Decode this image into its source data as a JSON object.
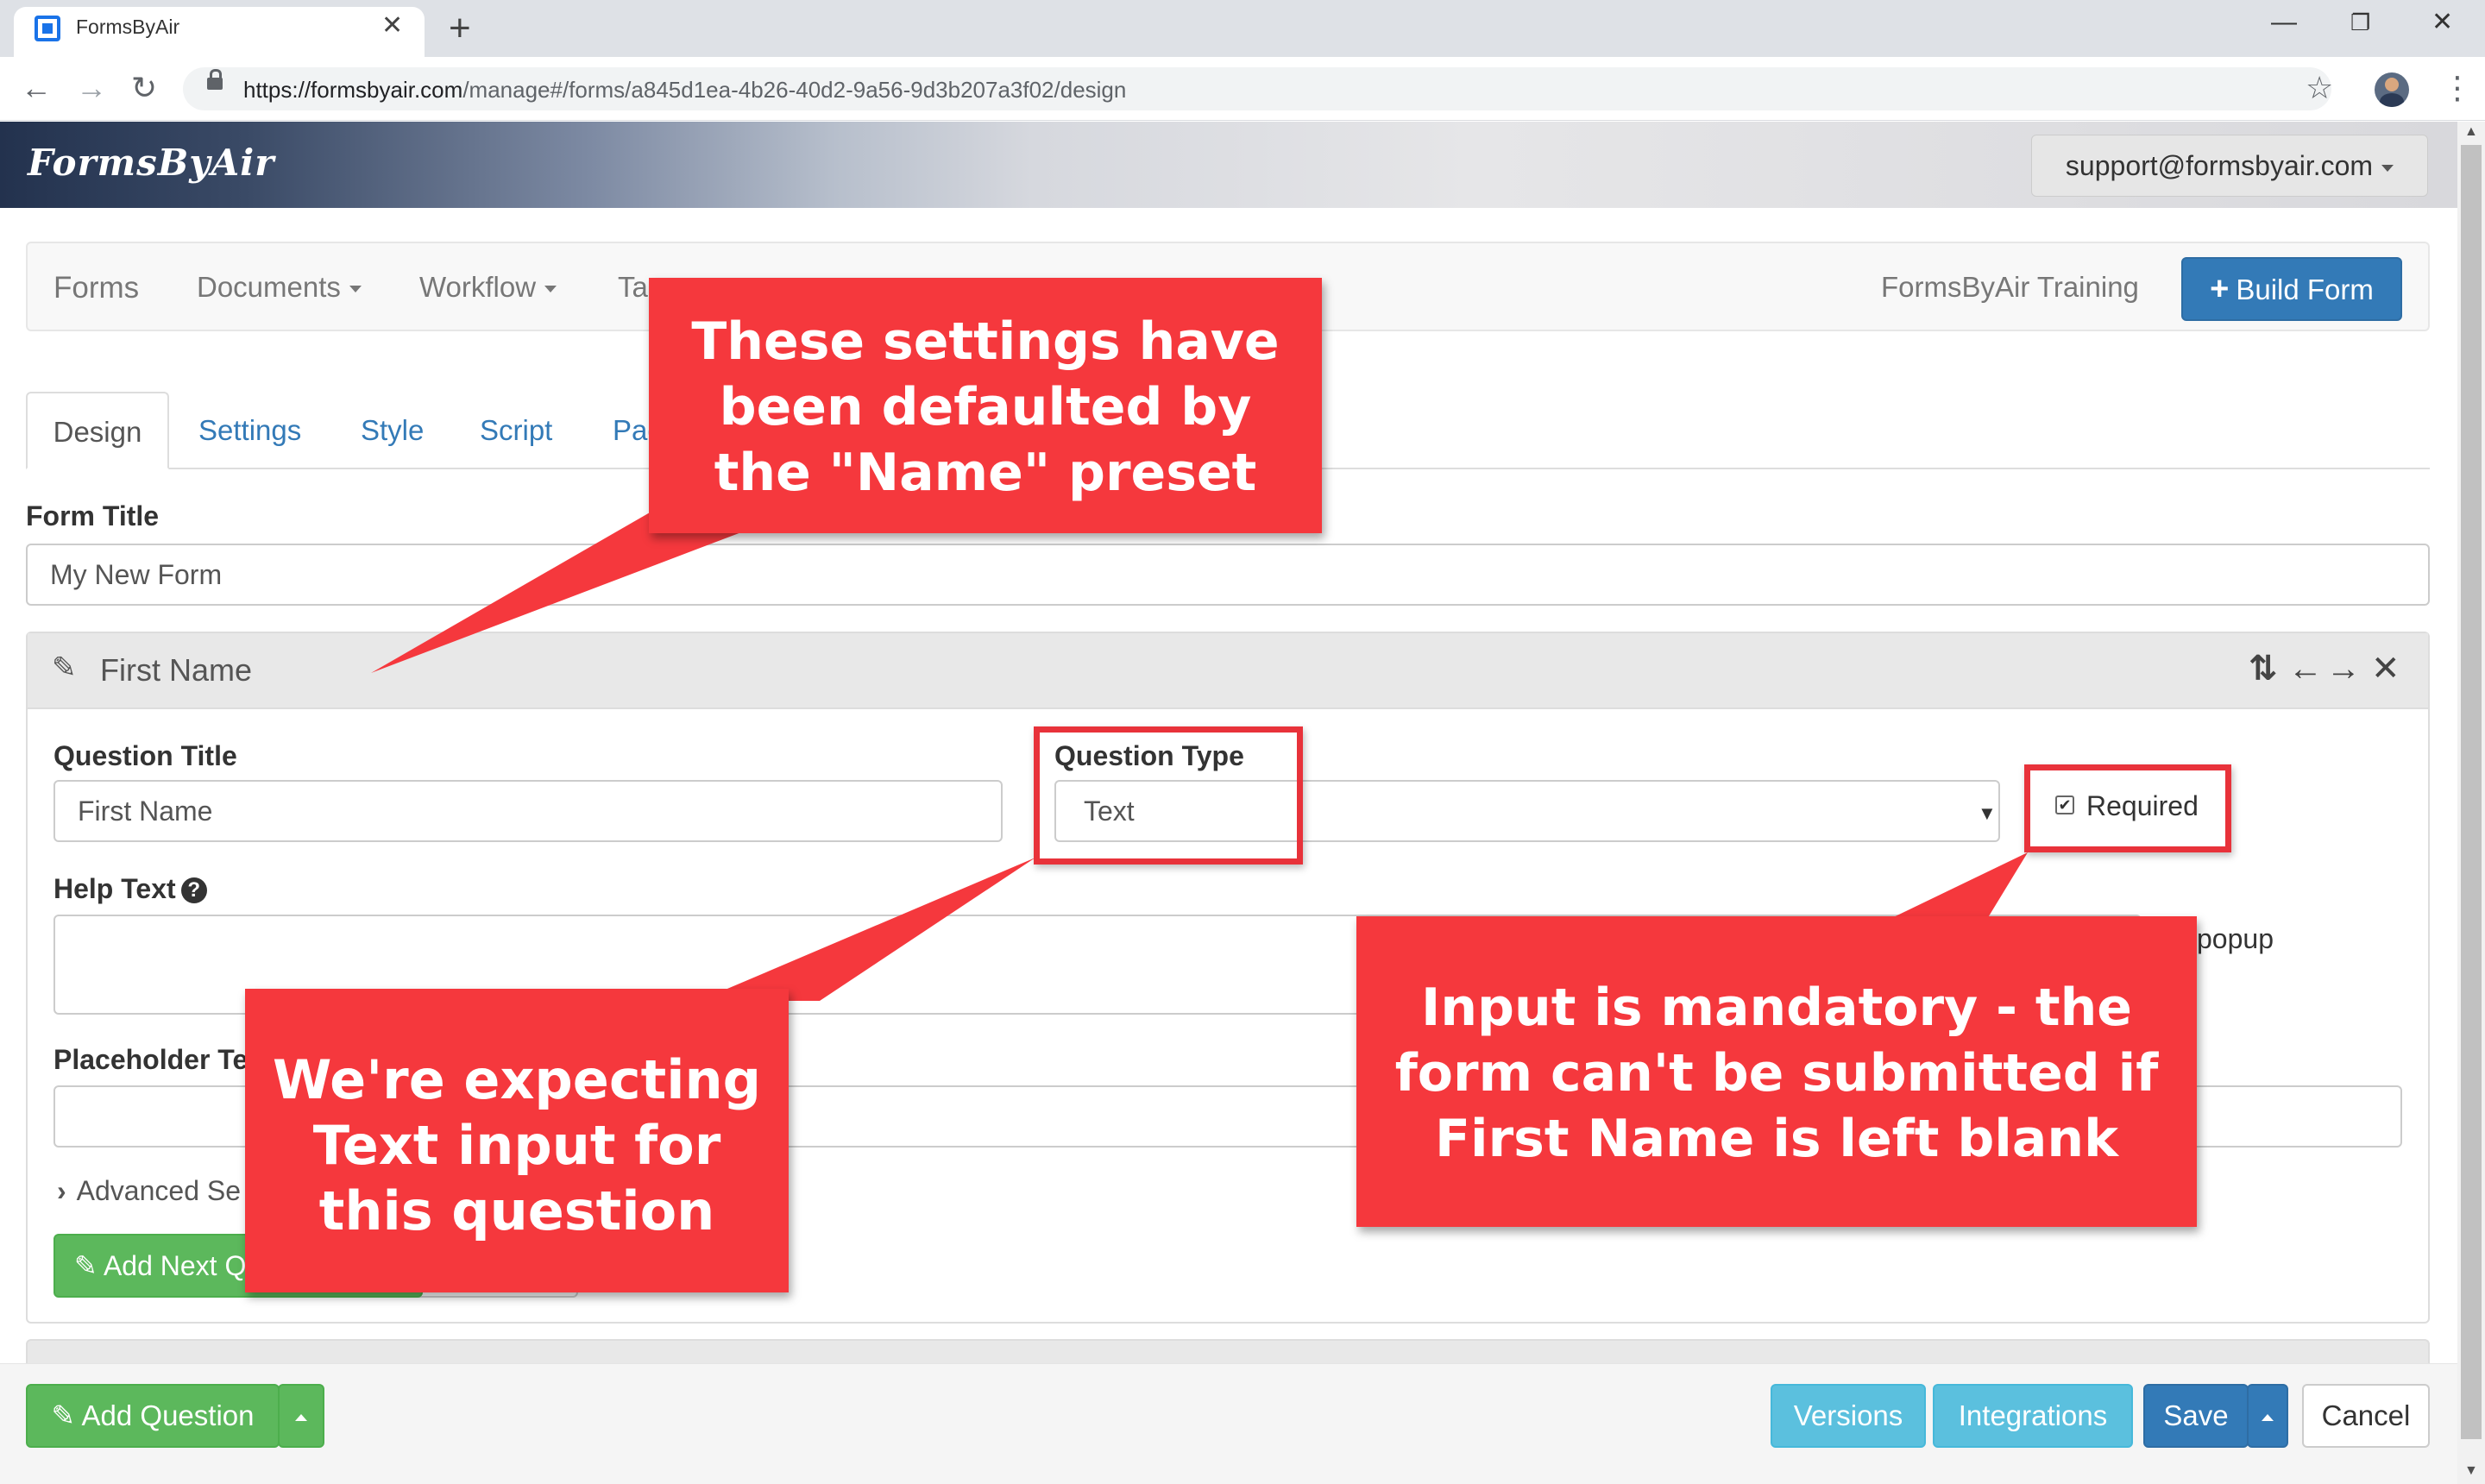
{
  "browser": {
    "tab_title": "FormsByAir",
    "url_host": "https://formsbyair.com",
    "url_path": "/manage#/forms/a845d1ea-4b26-40d2-9a56-9d3b207a3f02/design"
  },
  "header": {
    "brand": "FormsByAir",
    "user": "support@formsbyair.com"
  },
  "navbar": {
    "items": [
      "Forms",
      "Documents",
      "Workflow",
      "Ta"
    ],
    "org": "FormsByAir Training",
    "build_form": "Build Form"
  },
  "design_tabs": [
    "Design",
    "Settings",
    "Style",
    "Script",
    "Pag"
  ],
  "form_title": {
    "label": "Form Title",
    "value": "My New Form"
  },
  "question": {
    "header_title": "First Name",
    "title_label": "Question Title",
    "title_value": "First Name",
    "type_label": "Question Type",
    "type_value": "Text",
    "required_label": "Required",
    "required_checked": true,
    "help_label": "Help Text",
    "popup_label": "popup",
    "placeholder_label": "Placeholder Te",
    "advanced_label": "Advanced Se",
    "add_next_label": "Add Next Q"
  },
  "footer": {
    "add_question": "Add Question",
    "versions": "Versions",
    "integrations": "Integrations",
    "save": "Save",
    "cancel": "Cancel"
  },
  "annotations": {
    "preset_note": "These settings have been defaulted by the \"Name\" preset",
    "text_note": "We're expecting Text input for this question",
    "required_note": "Input is mandatory - the form can't be submitted if First Name is left blank"
  },
  "colors": {
    "callout_red": "#f5383d",
    "primary_blue": "#337ab7",
    "success_green": "#5cb85c",
    "info_cyan": "#5bc0de"
  }
}
